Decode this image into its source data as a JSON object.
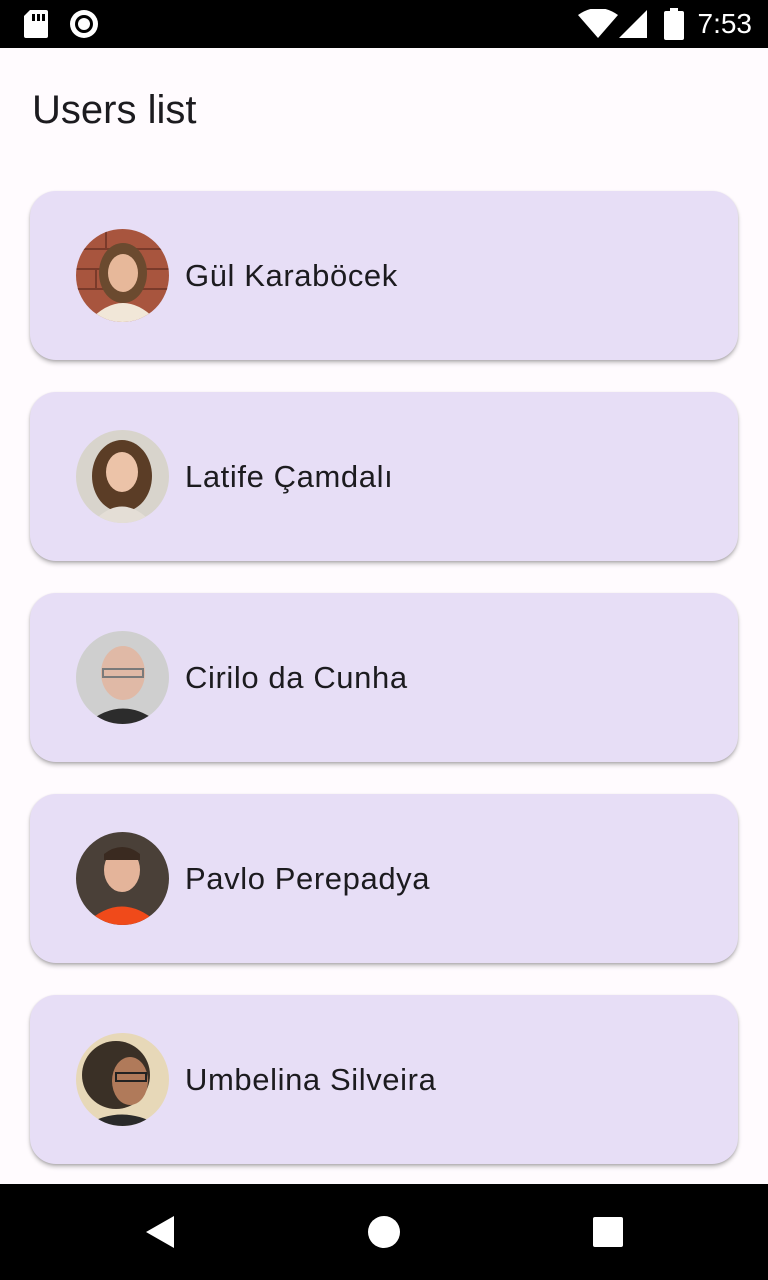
{
  "status_bar": {
    "time": "7:53",
    "icons": [
      "sd-card-icon",
      "record-icon",
      "wifi-icon",
      "signal-icon",
      "battery-icon"
    ]
  },
  "page": {
    "title": "Users list"
  },
  "users": [
    {
      "name": "Gül Karaböcek",
      "avatar": "avatar-photo"
    },
    {
      "name": "Latife Çamdalı",
      "avatar": "avatar-photo"
    },
    {
      "name": "Cirilo da Cunha",
      "avatar": "avatar-photo"
    },
    {
      "name": "Pavlo Perepadya",
      "avatar": "avatar-photo"
    },
    {
      "name": "Umbelina Silveira",
      "avatar": "avatar-photo"
    }
  ],
  "nav_bar": {
    "buttons": [
      "back-icon",
      "home-icon",
      "recents-icon"
    ]
  },
  "colors": {
    "card_background": "#e7def6",
    "page_background": "#fffbfe",
    "text": "#1c1b1f"
  }
}
